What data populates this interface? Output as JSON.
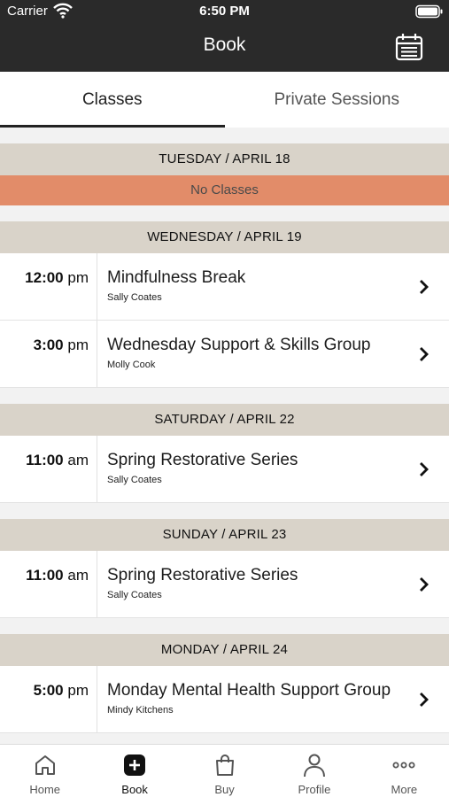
{
  "status_bar": {
    "carrier": "Carrier",
    "time": "6:50 PM"
  },
  "header": {
    "title": "Book"
  },
  "tabs": [
    {
      "label": "Classes",
      "active": true
    },
    {
      "label": "Private Sessions",
      "active": false
    }
  ],
  "days": [
    {
      "header": "TUESDAY / APRIL 18",
      "no_classes": "No Classes",
      "classes": []
    },
    {
      "header": "WEDNESDAY / APRIL 19",
      "classes": [
        {
          "time": "12:00",
          "ampm": "pm",
          "name": "Mindfulness Break",
          "teacher": "Sally Coates"
        },
        {
          "time": "3:00",
          "ampm": "pm",
          "name": "Wednesday Support & Skills Group",
          "teacher": "Molly Cook"
        }
      ]
    },
    {
      "header": "SATURDAY / APRIL 22",
      "classes": [
        {
          "time": "11:00",
          "ampm": "am",
          "name": "Spring Restorative Series",
          "teacher": "Sally Coates"
        }
      ]
    },
    {
      "header": "SUNDAY / APRIL 23",
      "classes": [
        {
          "time": "11:00",
          "ampm": "am",
          "name": "Spring Restorative Series",
          "teacher": "Sally Coates"
        }
      ]
    },
    {
      "header": "MONDAY / APRIL 24",
      "classes": [
        {
          "time": "5:00",
          "ampm": "pm",
          "name": "Monday Mental Health Support Group",
          "teacher": "Mindy Kitchens"
        }
      ]
    }
  ],
  "tabbar": [
    {
      "label": "Home",
      "icon": "home-icon"
    },
    {
      "label": "Book",
      "icon": "plus-icon",
      "active": true
    },
    {
      "label": "Buy",
      "icon": "bag-icon"
    },
    {
      "label": "Profile",
      "icon": "person-icon"
    },
    {
      "label": "More",
      "icon": "more-icon"
    }
  ],
  "colors": {
    "header_bg": "#2a2a2a",
    "day_header_bg": "#d9d3c9",
    "no_classes_bg": "#e28c69"
  }
}
